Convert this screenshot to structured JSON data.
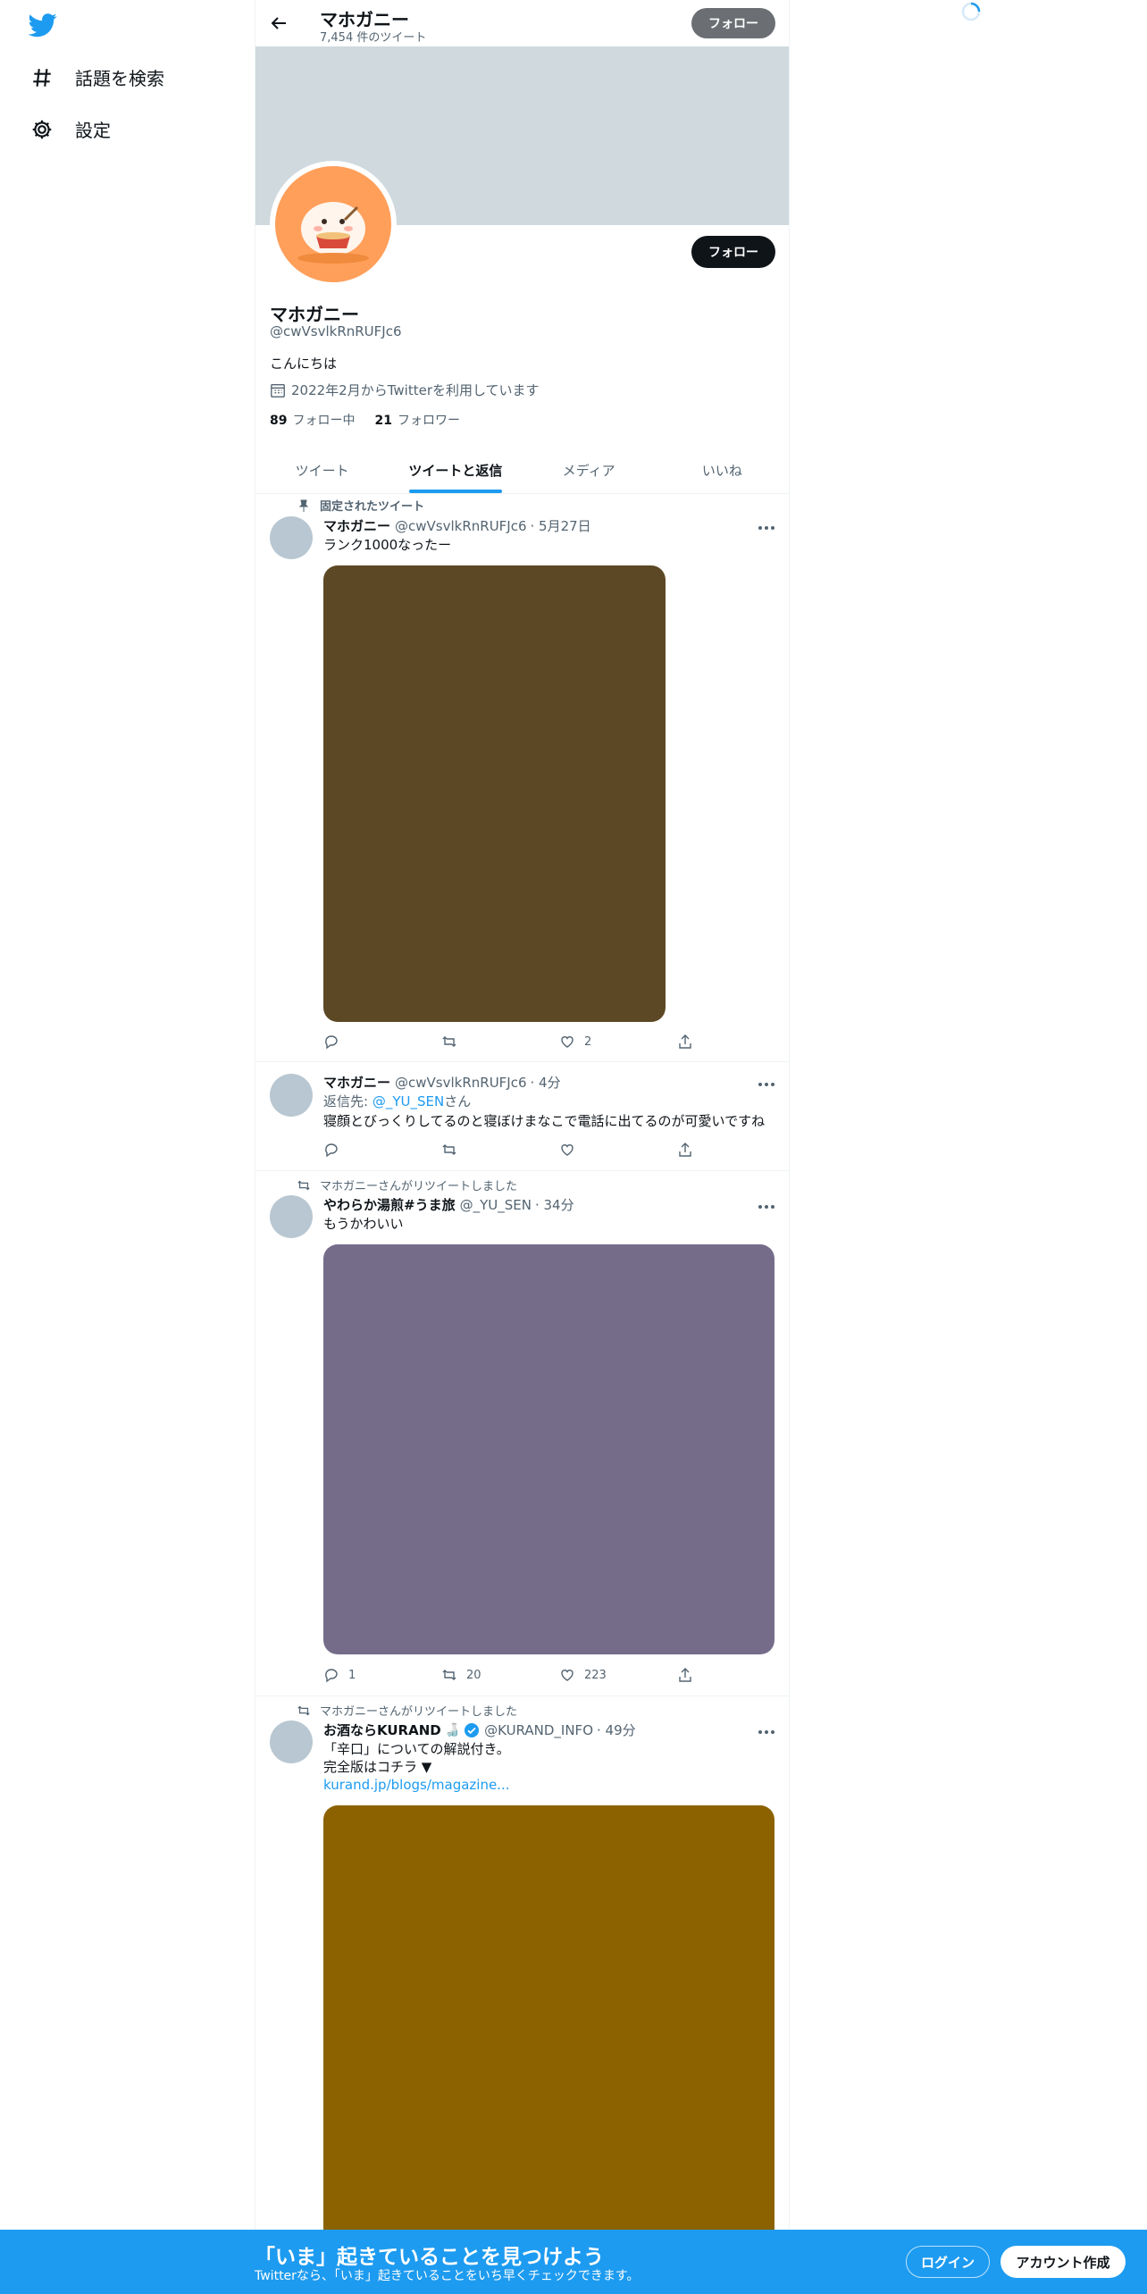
{
  "nav": {
    "explore_label": "話題を検索",
    "settings_label": "設定"
  },
  "header": {
    "name": "マホガニー",
    "tweet_count": "7,454 件のツイート",
    "follow_label": "フォロー"
  },
  "profile": {
    "follow_label": "フォロー",
    "name": "マホガニー",
    "handle": "@cwVsvlkRnRUFJc6",
    "bio": "こんにちは",
    "joined": "2022年2月からTwitterを利用しています",
    "following_count": "89",
    "following_label": "フォロー中",
    "followers_count": "21",
    "followers_label": "フォロワー"
  },
  "tabs": [
    {
      "label": "ツイート"
    },
    {
      "label": "ツイートと返信"
    },
    {
      "label": "メディア"
    },
    {
      "label": "いいね"
    }
  ],
  "tweets": [
    {
      "context": "固定されたツイート",
      "name": "マホガニー",
      "handle": "@cwVsvlkRnRUFJc6",
      "time": "· 5月27日",
      "text": "ランク1000なったー",
      "media_color": "#5c4824",
      "reply_count": "",
      "retweet_count": "",
      "like_count": "2"
    },
    {
      "name": "マホガニー",
      "handle": "@cwVsvlkRnRUFJc6",
      "time": "· 4分",
      "reply_to_prefix": "返信先: ",
      "reply_to_handle": "@_YU_SEN",
      "reply_to_suffix": "さん",
      "text": "寝顔とびっくりしてるのと寝ぼけまなこで電話に出てるのが可愛いですね",
      "reply_count": "",
      "retweet_count": "",
      "like_count": ""
    },
    {
      "context": "マホガニーさんがリツイートしました",
      "name": "やわらか湯煎#うま旅",
      "handle": "@_YU_SEN",
      "time": "· 34分",
      "text": "もうかわいい",
      "media_color": "#756c8a",
      "reply_count": "1",
      "retweet_count": "20",
      "like_count": "223"
    },
    {
      "context": "マホガニーさんがリツイートしました",
      "name": "お酒ならKURAND",
      "handle": "@KURAND_INFO",
      "time": "· 49分",
      "text_line1": "「辛口」についての解説付き。",
      "text_line2": "完全版はコチラ ▼",
      "link": "kurand.jp/blogs/magazine...",
      "media_color": "#8c6200",
      "verified_color": "#1d9bf0"
    }
  ],
  "bottom_bar": {
    "title": "「いま」起きていることを見つけよう",
    "subtitle": "Twitterなら、「いま」起きていることをいち早くチェックできます。",
    "login_label": "ログイン",
    "signup_label": "アカウント作成"
  },
  "colors": {
    "accent": "#1d9bf0",
    "banner": "#cfd9de",
    "avatar_bg": "#ff9f5a"
  }
}
